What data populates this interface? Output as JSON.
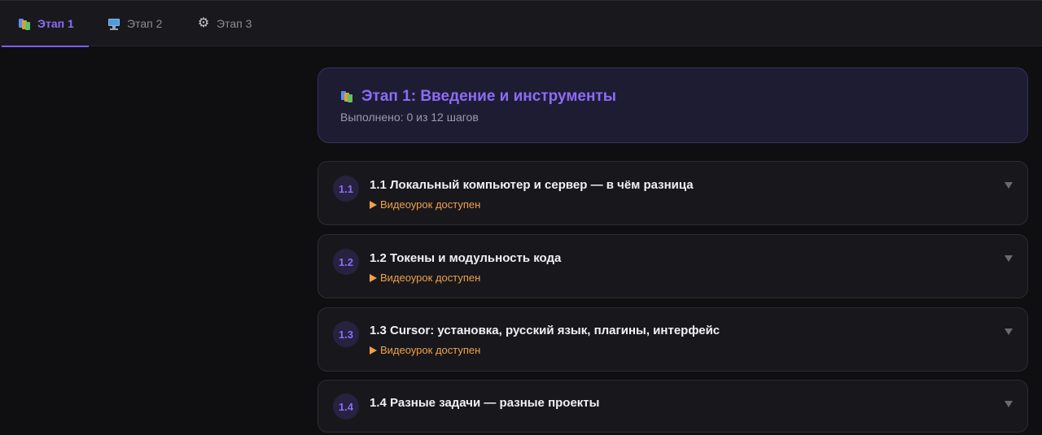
{
  "tabs": [
    {
      "label": "Этап 1",
      "icon": "books-icon",
      "active": true
    },
    {
      "label": "Этап 2",
      "icon": "monitor-icon",
      "active": false
    },
    {
      "label": "Этап 3",
      "icon": "gear-icon",
      "active": false
    }
  ],
  "stage": {
    "title": "Этап 1: Введение и инструменты",
    "progress_text": "Выполнено: 0 из 12 шагов",
    "icon": "books-icon"
  },
  "lessons": [
    {
      "number": "1.1",
      "title": "1.1 Локальный компьютер и сервер — в чём разница",
      "video_label": "Видеоурок доступен"
    },
    {
      "number": "1.2",
      "title": "1.2 Токены и модульность кода",
      "video_label": "Видеоурок доступен"
    },
    {
      "number": "1.3",
      "title": "1.3 Cursor: установка, русский язык, плагины, интерфейс",
      "video_label": "Видеоурок доступен"
    },
    {
      "number": "1.4",
      "title": "1.4 Разные задачи — разные проекты",
      "video_label": ""
    }
  ],
  "colors": {
    "accent": "#8b6cf6",
    "video": "#f0a04b",
    "background": "#0f0f12",
    "card": "#18181c",
    "header_card": "#1e1c33"
  }
}
